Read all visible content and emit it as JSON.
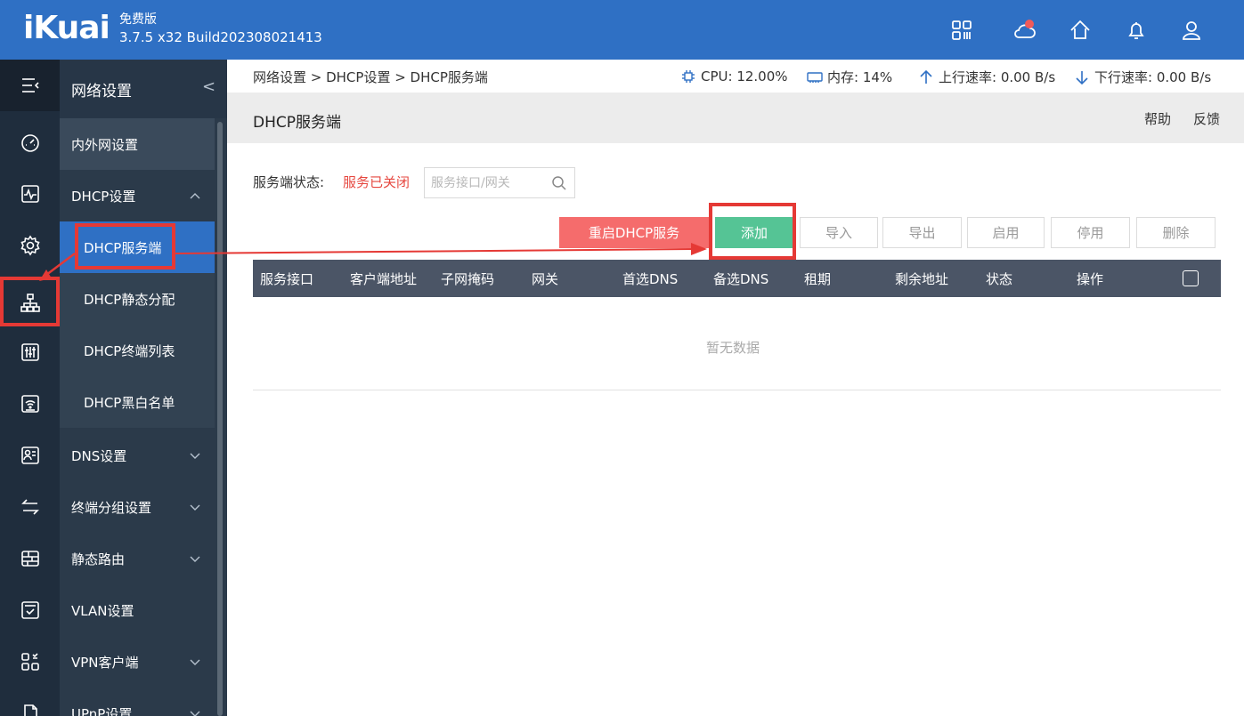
{
  "header": {
    "logo": "iKuai",
    "edition": "免费版",
    "version": "3.7.5 x32 Build202308021413",
    "icons": [
      "apps-icon",
      "cloud-icon",
      "home-icon",
      "bell-icon",
      "user-icon"
    ],
    "cloud_badge_color": "#f05a5a"
  },
  "rail": {
    "icons": [
      "menu-collapse-icon",
      "dashboard-icon",
      "monitor-icon",
      "settings-icon",
      "network-icon",
      "sliders-icon",
      "wifi-icon",
      "user-card-icon",
      "transfer-icon",
      "firewall-icon",
      "check-box-icon",
      "app-grid-icon",
      "document-icon"
    ]
  },
  "nav": {
    "section_title": "网络设置",
    "items": {
      "wan_lan": "内外网设置",
      "dhcp": "DHCP设置",
      "dhcp_server": "DHCP服务端",
      "dhcp_static": "DHCP静态分配",
      "dhcp_clients": "DHCP终端列表",
      "dhcp_blackwhite": "DHCP黑白名单",
      "dns": "DNS设置",
      "terminal_group": "终端分组设置",
      "static_route": "静态路由",
      "vlan": "VLAN设置",
      "vpn_client": "VPN客户端",
      "upnp": "UPnP设置"
    }
  },
  "topstatus": {
    "breadcrumb": "网络设置 > DHCP设置 > DHCP服务端",
    "cpu": "CPU: 12.00%",
    "memory": "内存: 14%",
    "upload": "上行速率: 0.00 B/s",
    "download": "下行速率: 0.00 B/s"
  },
  "page": {
    "title": "DHCP服务端",
    "help": "帮助",
    "feedback": "反馈",
    "service_status_label": "服务端状态:",
    "service_status_value": "服务已关闭",
    "search_placeholder": "服务接口/网关"
  },
  "toolbar": {
    "restart": "重启DHCP服务",
    "add": "添加",
    "import": "导入",
    "export": "导出",
    "enable": "启用",
    "disable": "停用",
    "delete": "删除"
  },
  "table": {
    "columns": [
      "服务接口",
      "客户端地址",
      "子网掩码",
      "网关",
      "首选DNS",
      "备选DNS",
      "租期",
      "剩余地址",
      "状态",
      "操作"
    ],
    "empty_text": "暂无数据"
  },
  "colors": {
    "header_blue": "#2f70c4",
    "rail_dark": "#1f2d3d",
    "nav_bg": "#2b3a4a",
    "active_blue": "#2f70c4",
    "restart_red": "#f56c6c",
    "add_green": "#55c495",
    "status_red": "#e6473f",
    "annotation_red": "#e53935"
  }
}
